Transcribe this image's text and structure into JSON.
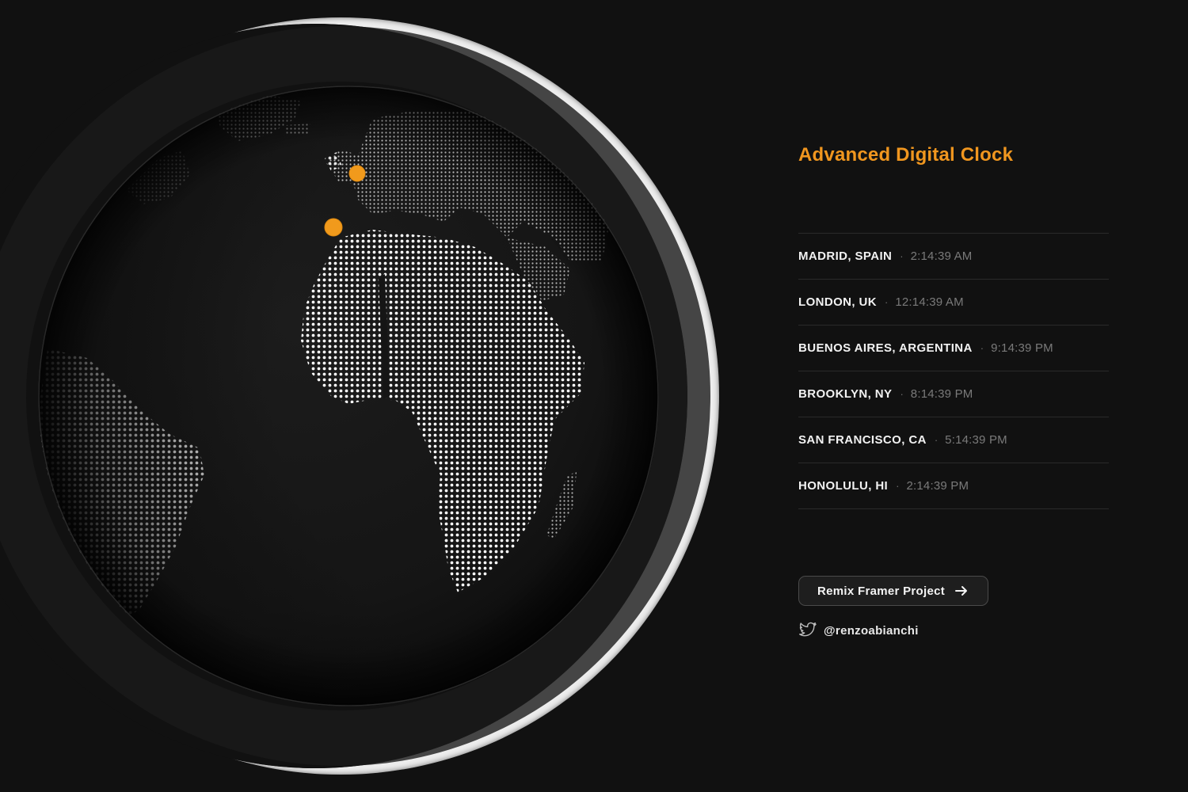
{
  "header": {
    "title": "Advanced Digital Clock",
    "accent_color": "#f0961f"
  },
  "globe": {
    "marker_color": "#f19a1c",
    "markers": [
      "madrid-marker",
      "london-marker"
    ]
  },
  "cities": [
    {
      "name": "MADRID, SPAIN",
      "separator": "·",
      "time": "2:14:39 AM"
    },
    {
      "name": "LONDON, UK",
      "separator": "·",
      "time": "12:14:39 AM"
    },
    {
      "name": "BUENOS AIRES, ARGENTINA",
      "separator": "·",
      "time": "9:14:39 PM"
    },
    {
      "name": "BROOKLYN, NY",
      "separator": "·",
      "time": "8:14:39 PM"
    },
    {
      "name": "SAN FRANCISCO, CA",
      "separator": "·",
      "time": "5:14:39 PM"
    },
    {
      "name": "HONOLULU, HI",
      "separator": "·",
      "time": "2:14:39 PM"
    }
  ],
  "actions": {
    "remix_label": "Remix Framer Project",
    "remix_icon": "arrow-right-icon",
    "twitter_icon": "twitter-icon",
    "twitter_handle": "@renzoabianchi"
  }
}
